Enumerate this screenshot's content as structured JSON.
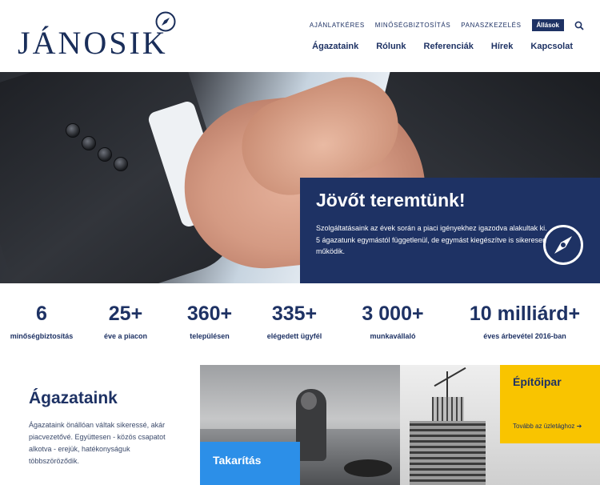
{
  "brand": {
    "name": "JÁNOSIK",
    "navy": "#1e3264",
    "blue": "#2c8fe8",
    "yellow": "#f9c400"
  },
  "topnav": {
    "items": [
      "AJÁNLATKÉRES",
      "MINŐSÉGBIZTOSÍTÁS",
      "PANASZKEZELÉS"
    ],
    "jobs": "Állások",
    "search_icon": "search-icon"
  },
  "mainnav": [
    "Ágazataink",
    "Rólunk",
    "Referenciák",
    "Hírek",
    "Kapcsolat"
  ],
  "hero": {
    "title": "Jövőt teremtünk!",
    "text": "Szolgáltatásaink az évek során a piaci igényekhez igazodva alakultak ki. 5 ágazatunk egymástól függetlenül, de egymást kiegészítve is sikeresen működik."
  },
  "stats": [
    {
      "num": "6",
      "label": "minőségbiztosítás"
    },
    {
      "num": "25+",
      "label": "éve a piacon"
    },
    {
      "num": "360+",
      "label": "településen"
    },
    {
      "num": "335+",
      "label": "elégedett ügyfél"
    },
    {
      "num": "3 000+",
      "label": "munkavállaló"
    },
    {
      "num": "10 milliárd+",
      "label": "éves árbevétel 2016-ban"
    }
  ],
  "sectors": {
    "title": "Ágazataink",
    "text": "Ágazataink önállóan váltak sikeressé, akár piacvezetővé. Együttesen - közös csapatot alkotva - erejük, hatékonyságuk többszöröződik.",
    "cleaning": "Takarítás",
    "construction": "Építőipar",
    "construction_more": "Tovább az üzletághoz"
  }
}
